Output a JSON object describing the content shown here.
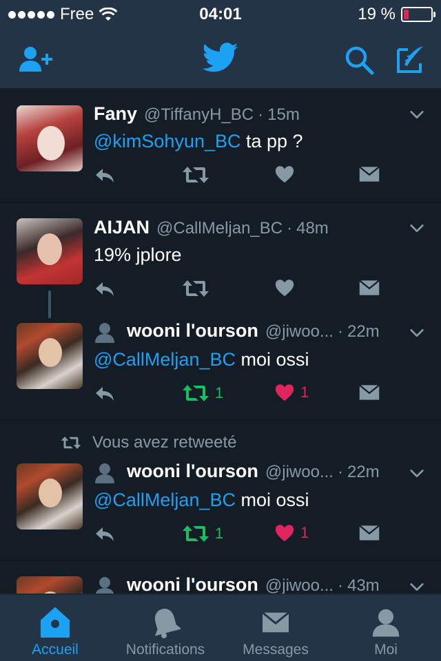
{
  "status_bar": {
    "carrier": "Free",
    "time": "04:01",
    "battery_percent": "19 %",
    "battery_level": 0.19,
    "battery_color": "#e0245e"
  },
  "nav": {
    "add_user_icon": "add-user-icon",
    "logo_icon": "twitter-bird-icon",
    "search_icon": "search-icon",
    "compose_icon": "compose-icon",
    "accent": "#1da1f2"
  },
  "tweets": [
    {
      "name": "Fany",
      "handle": "@TiffanyH_BC",
      "time": "15m",
      "mention": "@kimSohyun_BC",
      "text": " ta pp ?",
      "retweets": "",
      "likes": ""
    },
    {
      "name": "AIJAN",
      "handle": "@CallMeljan_BC",
      "time": "48m",
      "mention": "",
      "text": "19% jplore",
      "retweets": "",
      "likes": ""
    },
    {
      "name": "wooni l'ourson",
      "handle": "@jiwoo...",
      "time": "22m",
      "mention": "@CallMeljan_BC",
      "text": " moi ossi",
      "retweets": "1",
      "likes": "1"
    },
    {
      "retweet_banner": "Vous avez retweeté",
      "name": "wooni l'ourson",
      "handle": "@jiwoo...",
      "time": "22m",
      "mention": "@CallMeljan_BC",
      "text": " moi ossi",
      "retweets": "1",
      "likes": "1"
    },
    {
      "name": "wooni l'ourson",
      "handle": "@jiwoo...",
      "time": "43m"
    }
  ],
  "tabs": [
    {
      "label": "Accueil",
      "icon": "home-icon",
      "active": true
    },
    {
      "label": "Notifications",
      "icon": "bell-icon",
      "active": false
    },
    {
      "label": "Messages",
      "icon": "envelope-icon",
      "active": false
    },
    {
      "label": "Moi",
      "icon": "person-icon",
      "active": false
    }
  ],
  "colors": {
    "background": "#141d26",
    "bar": "#243447",
    "secondary_text": "#8899a6",
    "retweet_green": "#17bf63",
    "like_red": "#e0245e"
  }
}
